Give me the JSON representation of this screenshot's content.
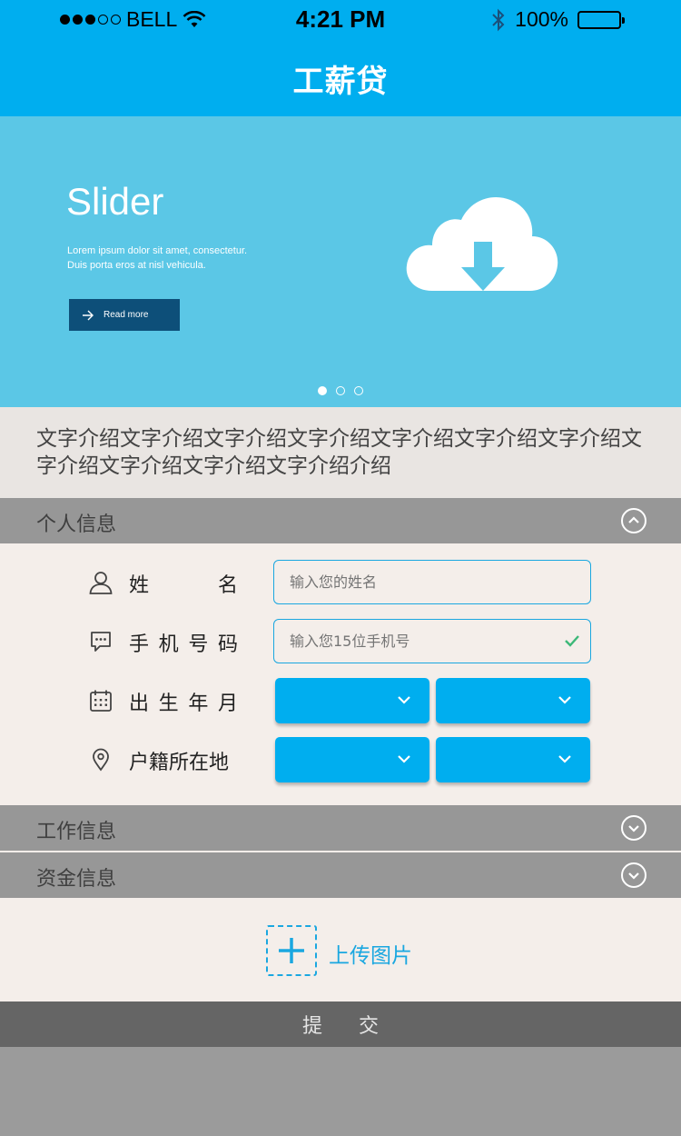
{
  "status_bar": {
    "carrier": "BELL",
    "time": "4:21 PM",
    "battery": "100%"
  },
  "header": {
    "title": "工薪贷"
  },
  "slider": {
    "title": "Slider",
    "text_line1": "Lorem ipsum dolor sit amet, consectetur.",
    "text_line2": "Duis porta eros at nisl vehicula.",
    "button_label": "Read more",
    "active_dot": 1,
    "dot_count": 3
  },
  "intro": {
    "text": "文字介绍文字介绍文字介绍文字介绍文字介绍文字介绍文字介绍文字介绍文字介绍文字介绍文字介绍介绍"
  },
  "sections": {
    "personal": {
      "label": "个人信息",
      "expanded": true
    },
    "work": {
      "label": "工作信息",
      "expanded": false
    },
    "funds": {
      "label": "资金信息",
      "expanded": false
    }
  },
  "form": {
    "name": {
      "label_a": "姓",
      "label_b": "名",
      "placeholder": "输入您的姓名"
    },
    "phone": {
      "label": "手机号码",
      "chars": [
        "手",
        "机",
        "号",
        "码"
      ],
      "placeholder": "输入您15位手机号"
    },
    "birth": {
      "chars": [
        "出",
        "生",
        "年",
        "月"
      ]
    },
    "hometown": {
      "label": "户籍所在地"
    }
  },
  "upload": {
    "label": "上传图片"
  },
  "submit": {
    "label": "提交"
  },
  "colors": {
    "accent": "#00aeef",
    "slider_bg": "#5bc7e6",
    "section_bg": "#979797",
    "form_bg": "#f4eeea",
    "submit_bg": "#656565"
  }
}
